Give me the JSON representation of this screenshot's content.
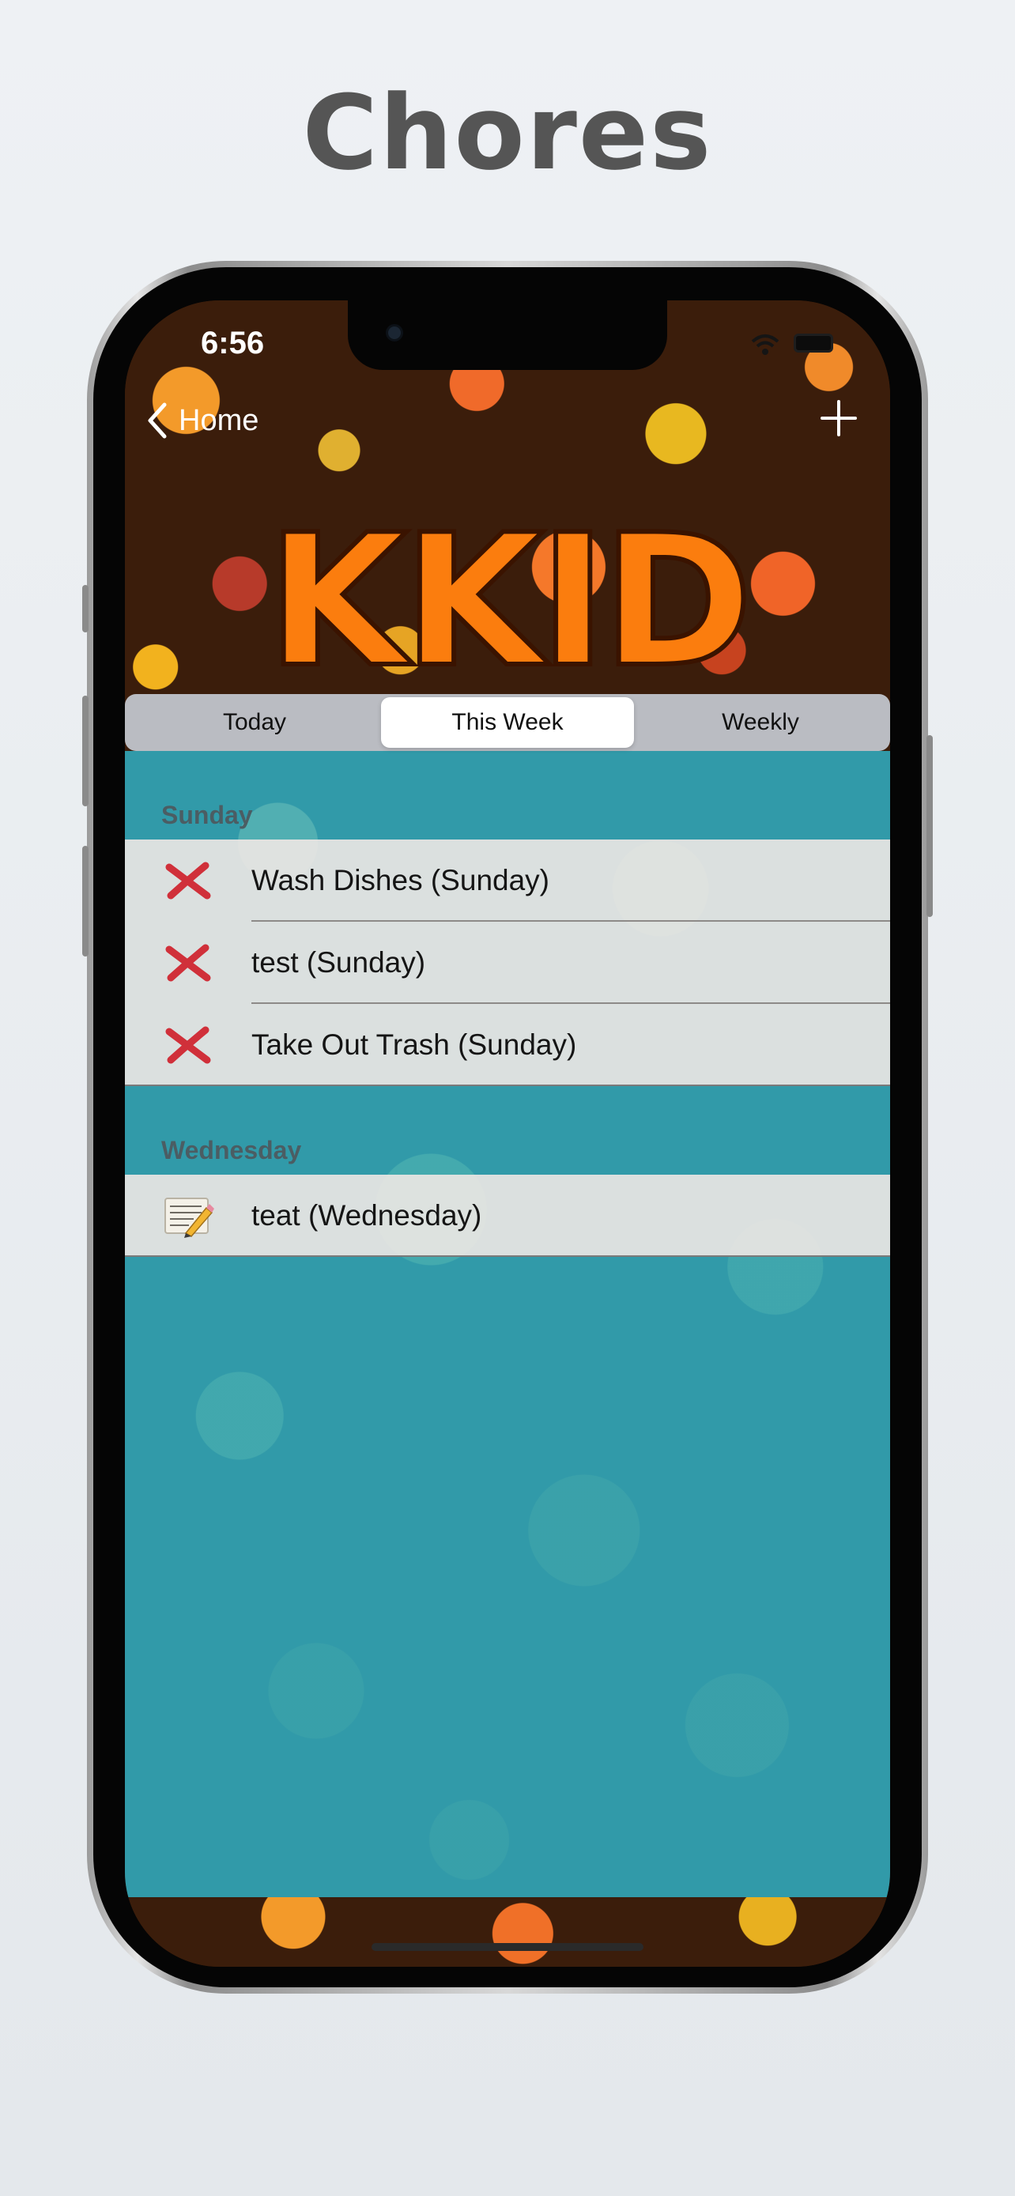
{
  "page_title": "Chores",
  "status_bar": {
    "time": "6:56"
  },
  "nav": {
    "back_label": "Home"
  },
  "logo_text": "KKID",
  "tabs": [
    {
      "label": "Today",
      "selected": false
    },
    {
      "label": "This Week",
      "selected": true
    },
    {
      "label": "Weekly",
      "selected": false
    }
  ],
  "sections": [
    {
      "header": "Sunday",
      "items": [
        {
          "label": "Wash Dishes (Sunday)",
          "icon": "x-mark-icon"
        },
        {
          "label": "test (Sunday)",
          "icon": "x-mark-icon"
        },
        {
          "label": "Take Out Trash (Sunday)",
          "icon": "x-mark-icon"
        }
      ]
    },
    {
      "header": "Wednesday",
      "items": [
        {
          "label": "teat (Wednesday)",
          "icon": "memo-icon"
        }
      ]
    }
  ],
  "colors": {
    "accent_orange": "#fb7d0e",
    "content_teal": "#319aa9",
    "x_red": "#d0303a"
  }
}
